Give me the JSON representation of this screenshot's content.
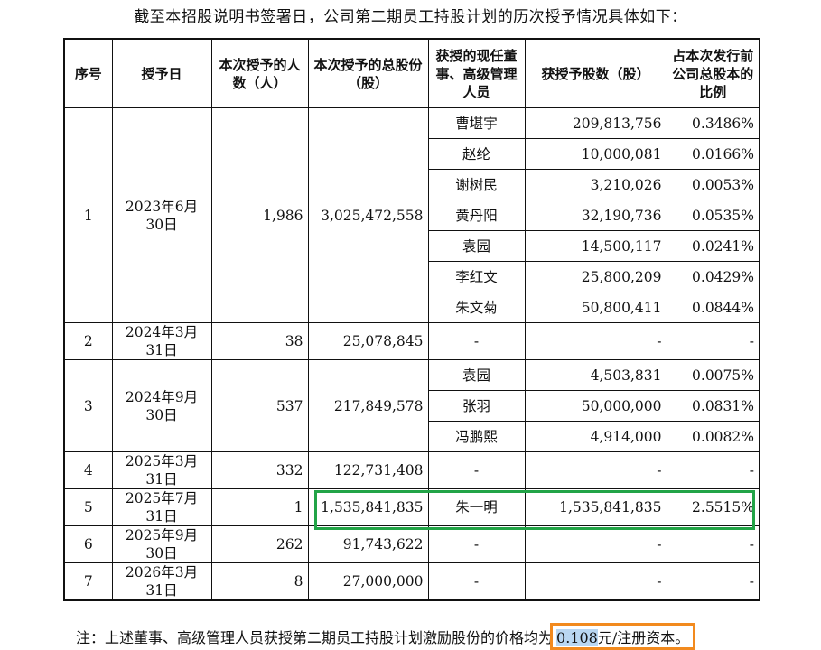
{
  "intro": "截至本招股说明书签署日，公司第二期员工持股计划的历次授予情况具体如下：",
  "headers": {
    "seq": "序号",
    "date": "授予日",
    "count": "本次授予的人数（人）",
    "total": "本次授予的总股份（股）",
    "person": "获授的现任董事、高级管理人员",
    "shares": "获授予股数（股）",
    "ratio": "占本次发行前公司总股本的比例"
  },
  "grants": [
    {
      "seq": "1",
      "date": "2023年6月30日",
      "count": "1,986",
      "total": "3,025,472,558",
      "recipients": [
        {
          "name": "曹堪宇",
          "shares": "209,813,756",
          "ratio": "0.3486%"
        },
        {
          "name": "赵纶",
          "shares": "10,000,081",
          "ratio": "0.0166%"
        },
        {
          "name": "谢树民",
          "shares": "3,210,026",
          "ratio": "0.0053%"
        },
        {
          "name": "黄丹阳",
          "shares": "32,190,736",
          "ratio": "0.0535%"
        },
        {
          "name": "袁园",
          "shares": "14,500,117",
          "ratio": "0.0241%"
        },
        {
          "name": "李红文",
          "shares": "25,800,209",
          "ratio": "0.0429%"
        },
        {
          "name": "朱文菊",
          "shares": "50,800,411",
          "ratio": "0.0844%"
        }
      ]
    },
    {
      "seq": "2",
      "date": "2024年3月31日",
      "count": "38",
      "total": "25,078,845",
      "recipients": [
        {
          "name": "-",
          "shares": "-",
          "ratio": "-"
        }
      ]
    },
    {
      "seq": "3",
      "date": "2024年9月30日",
      "count": "537",
      "total": "217,849,578",
      "recipients": [
        {
          "name": "袁园",
          "shares": "4,503,831",
          "ratio": "0.0075%"
        },
        {
          "name": "张羽",
          "shares": "50,000,000",
          "ratio": "0.0831%"
        },
        {
          "name": "冯鹏熙",
          "shares": "4,914,000",
          "ratio": "0.0082%"
        }
      ]
    },
    {
      "seq": "4",
      "date": "2025年3月31日",
      "count": "332",
      "total": "122,731,408",
      "recipients": [
        {
          "name": "-",
          "shares": "-",
          "ratio": "-"
        }
      ]
    },
    {
      "seq": "5",
      "date": "2025年7月31日",
      "count": "1",
      "total": "1,535,841,835",
      "recipients": [
        {
          "name": "朱一明",
          "shares": "1,535,841,835",
          "ratio": "2.5515%"
        }
      ]
    },
    {
      "seq": "6",
      "date": "2025年9月30日",
      "count": "262",
      "total": "91,743,622",
      "recipients": [
        {
          "name": "-",
          "shares": "-",
          "ratio": "-"
        }
      ]
    },
    {
      "seq": "7",
      "date": "2026年3月31日",
      "count": "8",
      "total": "27,000,000",
      "recipients": [
        {
          "name": "-",
          "shares": "-",
          "ratio": "-"
        }
      ]
    }
  ],
  "note": {
    "prefix": "注：上述董事、高级管理人员获授第二期员工持股计划激励股份的价格均为",
    "price": "0.108",
    "suffix": "元/注册资本。"
  },
  "highlight_colors": {
    "green": "#22a447",
    "orange": "#f28a1e",
    "blue": "#b9d7f2"
  }
}
